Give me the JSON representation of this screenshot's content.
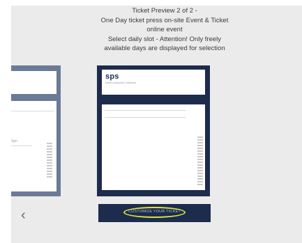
{
  "header": {
    "lines": [
      "Ticket Preview 2 of 2 -",
      "One Day ticket press on-site Event & Ticket",
      "online event",
      "Select daily slot - Attention! Only freely",
      "available days are displayed for selection"
    ]
  },
  "left_ticket": {
    "partial_text": "Spn"
  },
  "ticket": {
    "logo": "sps",
    "logo_subtitle": "smart production solutions"
  },
  "nav": {
    "prev_icon": "chevron-left-icon",
    "prev_glyph": "‹"
  },
  "customize_button": {
    "label": "CUSTOMIZE YOUR TICKET"
  },
  "colors": {
    "background": "#ebebeb",
    "ticket_navy": "#1d2b4d",
    "ticket_side_gray_blue": "#6b7a96",
    "highlight_ring": "#d7e63a"
  }
}
